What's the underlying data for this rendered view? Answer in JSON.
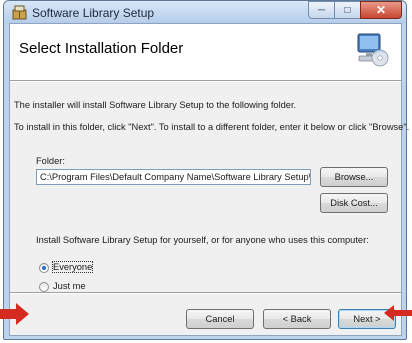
{
  "window": {
    "title": "Software Library Setup"
  },
  "banner": {
    "title": "Select Installation Folder"
  },
  "body": {
    "line1": "The installer will install Software Library Setup to the following folder.",
    "line2": "To install in this folder, click \"Next\". To install to a different folder, enter it below or click \"Browse\"."
  },
  "folder": {
    "label": "Folder:",
    "value": "C:\\Program Files\\Default Company Name\\Software Library Setup\\",
    "browse_label": "Browse...",
    "disk_cost_label": "Disk Cost..."
  },
  "scope": {
    "prompt": "Install Software Library Setup for yourself, or for anyone who uses this computer:",
    "options": [
      {
        "label": "Everyone",
        "selected": true
      },
      {
        "label": "Just me",
        "selected": false
      }
    ]
  },
  "buttons": {
    "cancel": "Cancel",
    "back": "< Back",
    "next": "Next >"
  },
  "annotation_arrow_color": "#d42a1f"
}
